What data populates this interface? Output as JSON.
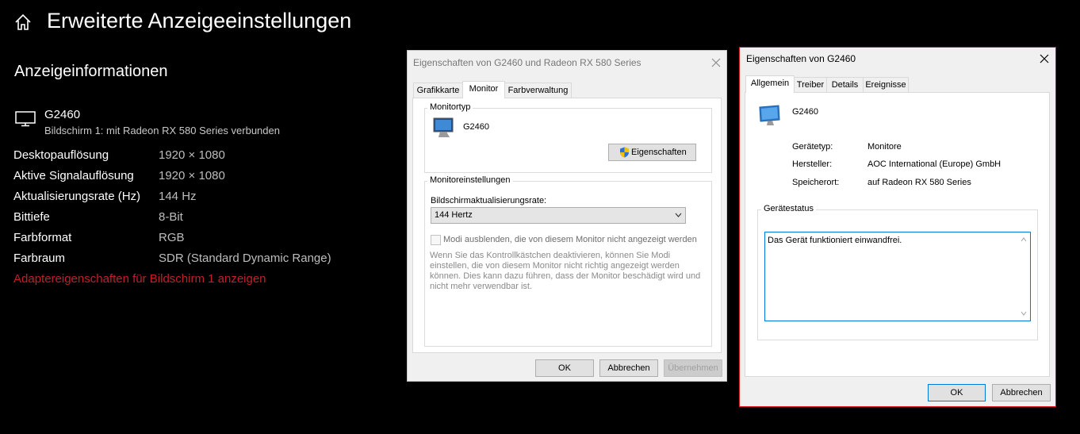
{
  "settings": {
    "title": "Erweiterte Anzeigeeinstellungen",
    "section_title": "Anzeigeinformationen",
    "monitor": {
      "name": "G2460",
      "subtitle": "Bildschirm 1: mit Radeon RX 580 Series verbunden"
    },
    "rows": [
      {
        "label": "Desktopauflösung",
        "value": "1920 × 1080"
      },
      {
        "label": "Aktive Signalauflösung",
        "value": "1920 × 1080"
      },
      {
        "label": "Aktualisierungsrate (Hz)",
        "value": "144 Hz"
      },
      {
        "label": "Bittiefe",
        "value": "8-Bit"
      },
      {
        "label": "Farbformat",
        "value": "RGB"
      },
      {
        "label": "Farbraum",
        "value": "SDR (Standard Dynamic Range)"
      }
    ],
    "adapter_link": "Adaptereigenschaften für Bildschirm 1 anzeigen"
  },
  "dialog_adapter": {
    "title": "Eigenschaften von G2460 und Radeon RX 580 Series",
    "tabs": [
      {
        "label": "Grafikkarte"
      },
      {
        "label": "Monitor"
      },
      {
        "label": "Farbverwaltung"
      }
    ],
    "active_tab": "Monitor",
    "monitor_type_group": "Monitortyp",
    "monitor_name": "G2460",
    "properties_button": "Eigenschaften",
    "settings_group": "Monitoreinstellungen",
    "refresh_label": "Bildschirmaktualisierungsrate:",
    "refresh_value": "144 Hertz",
    "hide_modes_label": "Modi ausblenden, die von diesem Monitor nicht angezeigt werden",
    "hide_modes_checked": false,
    "hint": "Wenn Sie das Kontrollkästchen deaktivieren, können Sie Modi einstellen, die von diesem Monitor nicht richtig angezeigt werden können. Dies kann dazu führen, dass der Monitor beschädigt wird und nicht mehr verwendbar ist.",
    "buttons": {
      "ok": "OK",
      "cancel": "Abbrechen",
      "apply": "Übernehmen"
    }
  },
  "dialog_device": {
    "title": "Eigenschaften von G2460",
    "tabs": [
      {
        "label": "Allgemein"
      },
      {
        "label": "Treiber"
      },
      {
        "label": "Details"
      },
      {
        "label": "Ereignisse"
      }
    ],
    "active_tab": "Allgemein",
    "device_name": "G2460",
    "props": [
      {
        "label": "Gerätetyp:",
        "value": "Monitore"
      },
      {
        "label": "Hersteller:",
        "value": "AOC International (Europe) GmbH"
      },
      {
        "label": "Speicherort:",
        "value": "auf Radeon RX 580 Series"
      }
    ],
    "status_group": "Gerätestatus",
    "status_text": "Das Gerät funktioniert einwandfrei.",
    "buttons": {
      "ok": "OK",
      "cancel": "Abbrechen"
    }
  },
  "colors": {
    "accent_link": "#c21f2b",
    "focus_border": "#0078d7",
    "active_window_border": "#e1131f"
  }
}
